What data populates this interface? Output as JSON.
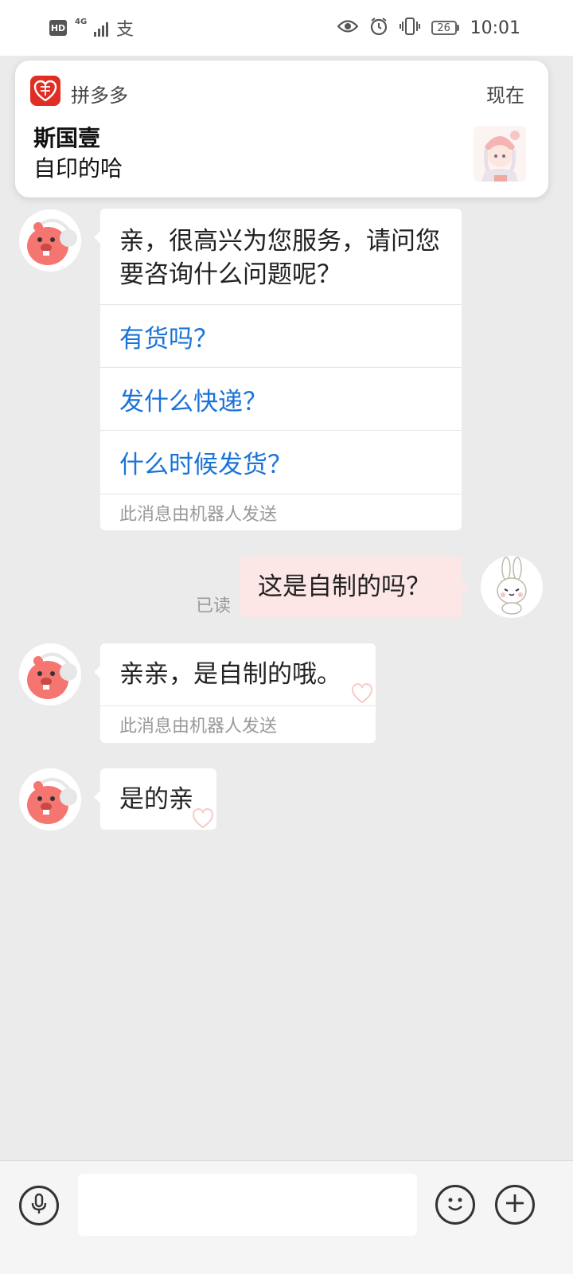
{
  "status_bar": {
    "hd": "HD",
    "network": "4G",
    "pay_glyph": "支",
    "battery": "26",
    "time": "10:01",
    "icons": [
      "hd-icon",
      "signal-icon",
      "alipay-icon",
      "eye-icon",
      "alarm-icon",
      "vibrate-icon",
      "battery-icon"
    ]
  },
  "notification": {
    "app_name": "拼多多",
    "time": "现在",
    "sender": "斯国壹",
    "message": "自印的哈",
    "accent": "#e02e24"
  },
  "chat": {
    "welcome": {
      "text": "亲，很高兴为您服务，请问您要咨询什么问题呢？",
      "quick_replies": [
        "有货吗？",
        "发什么快递？",
        "什么时候发货？"
      ],
      "robot_note": "此消息由机器人发送"
    },
    "outgoing": {
      "text": "这是自制的吗？",
      "read_status": "已读"
    },
    "reply1": {
      "text": "亲亲，是自制的哦。",
      "robot_note": "此消息由机器人发送"
    },
    "reply2": {
      "text": "是的亲"
    }
  },
  "input_bar": {
    "placeholder": "",
    "icons": [
      "microphone-icon",
      "emoji-icon",
      "plus-icon"
    ]
  },
  "colors": {
    "background": "#ebebeb",
    "link_blue": "#1a73d9",
    "outgoing_bubble": "#fde7e6"
  }
}
